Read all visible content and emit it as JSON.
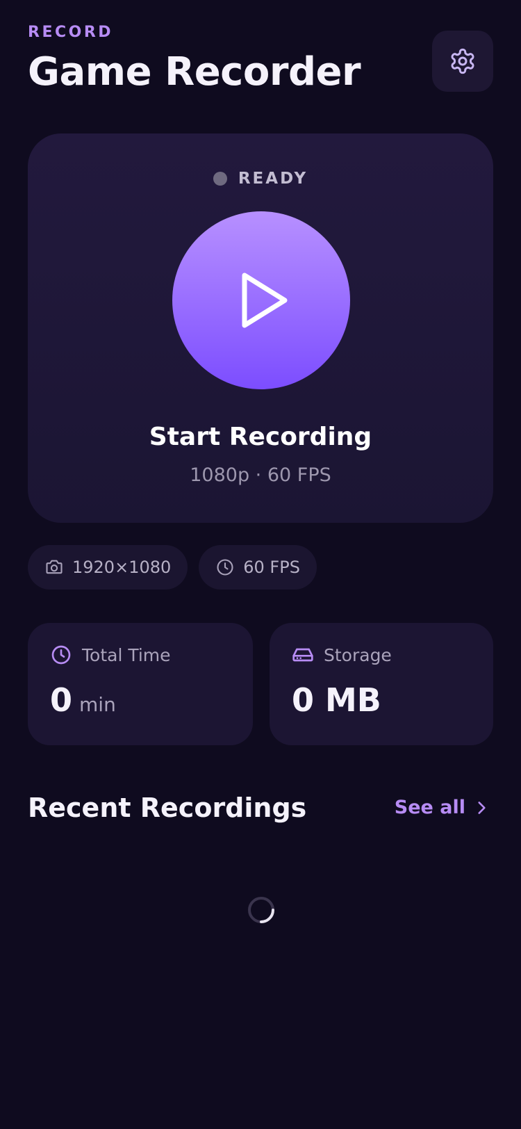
{
  "header": {
    "eyebrow": "RECORD",
    "title": "Game Recorder",
    "settings_icon": "gear-icon"
  },
  "recorder": {
    "status": "READY",
    "status_dot_color": "#6f6a80",
    "button_icon": "play-icon",
    "action_label": "Start Recording",
    "quality_summary": "1080p · 60 FPS"
  },
  "chips": [
    {
      "icon": "camera-icon",
      "label": "1920×1080"
    },
    {
      "icon": "clock-icon",
      "label": "60 FPS"
    }
  ],
  "stats": {
    "total_time": {
      "icon": "clock-icon",
      "label": "Total Time",
      "value": "0",
      "unit": "min"
    },
    "storage": {
      "icon": "hard-drive-icon",
      "label": "Storage",
      "value": "0 MB"
    }
  },
  "recent": {
    "title": "Recent Recordings",
    "see_all_label": "See all",
    "loading_icon": "loading-spinner-icon"
  },
  "colors": {
    "background": "#0f0b1f",
    "accent": "#b78cf4",
    "button_gradient_top": "#b790ff",
    "button_gradient_bottom": "#7c4dff"
  }
}
